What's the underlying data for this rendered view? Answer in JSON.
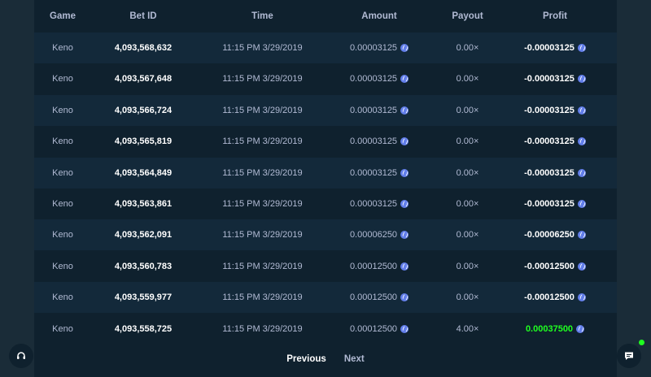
{
  "columns": [
    "Game",
    "Bet ID",
    "Time",
    "Amount",
    "Payout",
    "Profit"
  ],
  "rows": [
    {
      "game": "Keno",
      "bet_id": "4,093,568,632",
      "time": "11:15 PM 3/29/2019",
      "amount": "0.00003125",
      "payout": "0.00×",
      "profit": "-0.00003125",
      "win": false
    },
    {
      "game": "Keno",
      "bet_id": "4,093,567,648",
      "time": "11:15 PM 3/29/2019",
      "amount": "0.00003125",
      "payout": "0.00×",
      "profit": "-0.00003125",
      "win": false
    },
    {
      "game": "Keno",
      "bet_id": "4,093,566,724",
      "time": "11:15 PM 3/29/2019",
      "amount": "0.00003125",
      "payout": "0.00×",
      "profit": "-0.00003125",
      "win": false
    },
    {
      "game": "Keno",
      "bet_id": "4,093,565,819",
      "time": "11:15 PM 3/29/2019",
      "amount": "0.00003125",
      "payout": "0.00×",
      "profit": "-0.00003125",
      "win": false
    },
    {
      "game": "Keno",
      "bet_id": "4,093,564,849",
      "time": "11:15 PM 3/29/2019",
      "amount": "0.00003125",
      "payout": "0.00×",
      "profit": "-0.00003125",
      "win": false
    },
    {
      "game": "Keno",
      "bet_id": "4,093,563,861",
      "time": "11:15 PM 3/29/2019",
      "amount": "0.00003125",
      "payout": "0.00×",
      "profit": "-0.00003125",
      "win": false
    },
    {
      "game": "Keno",
      "bet_id": "4,093,562,091",
      "time": "11:15 PM 3/29/2019",
      "amount": "0.00006250",
      "payout": "0.00×",
      "profit": "-0.00006250",
      "win": false
    },
    {
      "game": "Keno",
      "bet_id": "4,093,560,783",
      "time": "11:15 PM 3/29/2019",
      "amount": "0.00012500",
      "payout": "0.00×",
      "profit": "-0.00012500",
      "win": false
    },
    {
      "game": "Keno",
      "bet_id": "4,093,559,977",
      "time": "11:15 PM 3/29/2019",
      "amount": "0.00012500",
      "payout": "0.00×",
      "profit": "-0.00012500",
      "win": false
    },
    {
      "game": "Keno",
      "bet_id": "4,093,558,725",
      "time": "11:15 PM 3/29/2019",
      "amount": "0.00012500",
      "payout": "4.00×",
      "profit": "0.00037500",
      "win": true
    }
  ],
  "pagination": {
    "previous": "Previous",
    "next": "Next"
  },
  "icons": {
    "currency": "ethereum-coin-icon",
    "support": "headset-icon",
    "chat": "chat-bubble-icon"
  },
  "colors": {
    "background": "#1a2c38",
    "panel": "#0f212e",
    "row_alt": "#13293a",
    "win": "#1fff20",
    "coin": "#627eea"
  }
}
